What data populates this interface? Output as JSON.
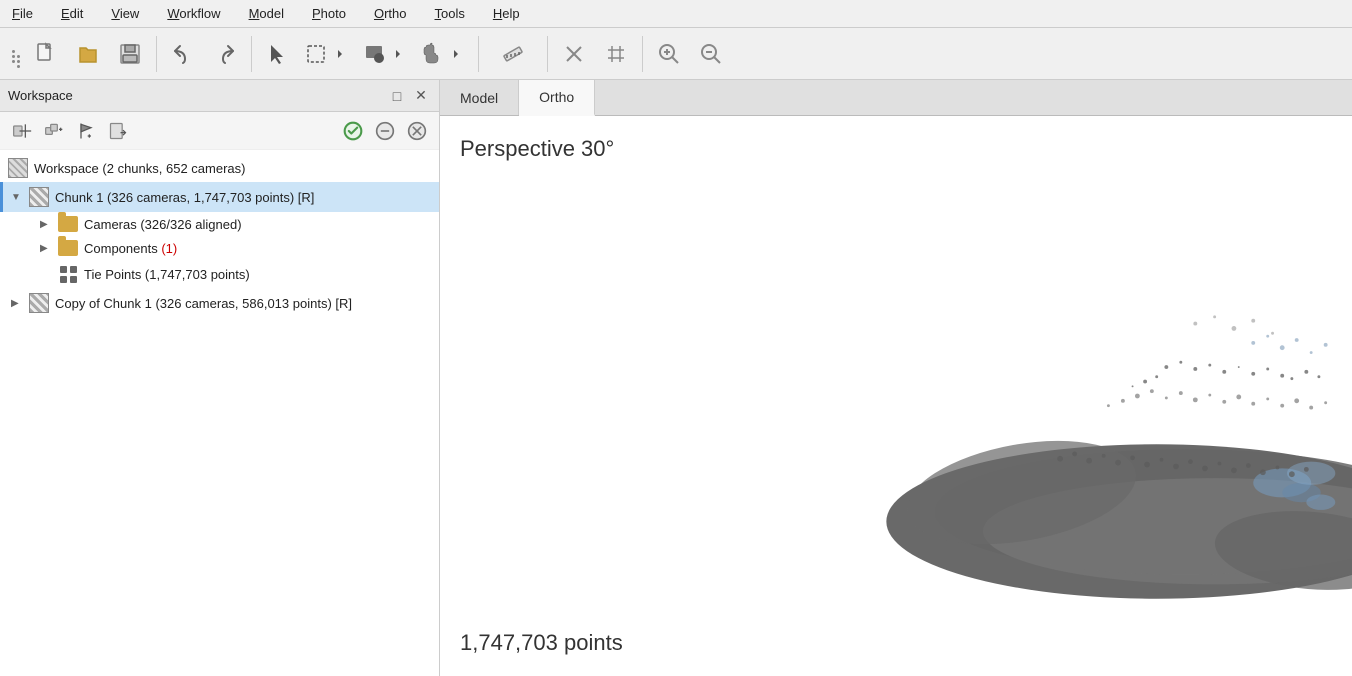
{
  "menubar": {
    "items": [
      {
        "label": "File",
        "underline_index": 0
      },
      {
        "label": "Edit",
        "underline_index": 0
      },
      {
        "label": "View",
        "underline_index": 0
      },
      {
        "label": "Workflow",
        "underline_index": 0
      },
      {
        "label": "Model",
        "underline_index": 0
      },
      {
        "label": "Photo",
        "underline_index": 0
      },
      {
        "label": "Ortho",
        "underline_index": 0
      },
      {
        "label": "Tools",
        "underline_index": 0
      },
      {
        "label": "Help",
        "underline_index": 0
      }
    ]
  },
  "workspace": {
    "title": "Workspace",
    "root_item": "Workspace (2 chunks, 652 cameras)",
    "chunks": [
      {
        "id": "chunk1",
        "label": "Chunk 1 (326 cameras, 1,747,703 points) [R]",
        "active": true,
        "children": [
          {
            "type": "folder",
            "label": "Cameras (326/326 aligned)"
          },
          {
            "type": "folder",
            "label": "Components (1)",
            "has_count": true
          },
          {
            "type": "points",
            "label": "Tie Points (1,747,703 points)"
          }
        ]
      },
      {
        "id": "chunk2",
        "label": "Copy of Chunk 1 (326 cameras, 586,013 points) [R]",
        "active": false,
        "children": []
      }
    ]
  },
  "view": {
    "tabs": [
      {
        "label": "Model",
        "active": false
      },
      {
        "label": "Ortho",
        "active": true
      }
    ],
    "perspective_label": "Perspective 30°",
    "points_label": "1,747,703 points"
  }
}
